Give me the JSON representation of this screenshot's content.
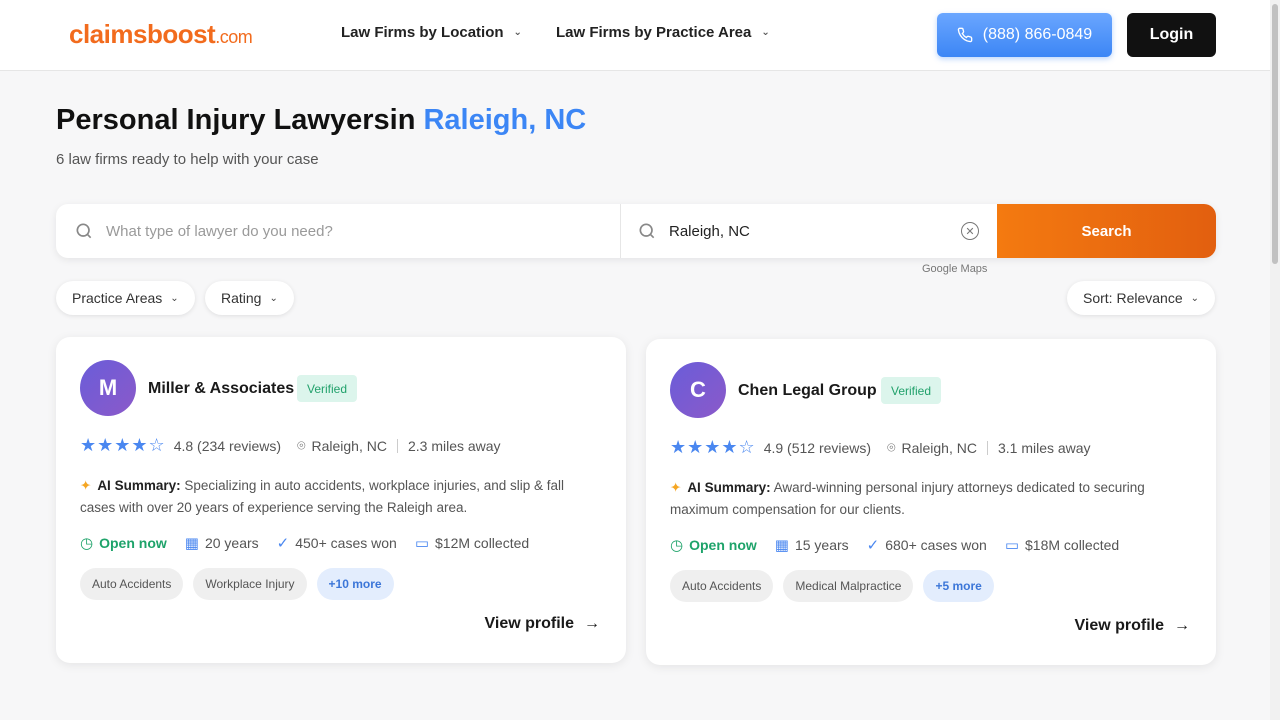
{
  "header": {
    "logo_main": "claimsboost",
    "logo_tld": ".com",
    "nav": [
      {
        "label": "Law Firms by Location"
      },
      {
        "label": "Law Firms by Practice Area"
      }
    ],
    "phone": "(888) 866-0849",
    "login": "Login"
  },
  "hero": {
    "title_prefix": "Personal Injury Lawyersin",
    "title_city": "Raleigh, NC",
    "subtitle": "6 law firms ready to help with your case"
  },
  "search": {
    "what_placeholder": "What type of lawyer do you need?",
    "location_value": "Raleigh, NC",
    "button": "Search",
    "attribution": "Google Maps"
  },
  "filters": {
    "practice_areas": "Practice Areas",
    "rating": "Rating",
    "sort": "Sort: Relevance"
  },
  "firms": [
    {
      "initial": "M",
      "name": "Miller & Associates",
      "verified": "Verified",
      "stars": "★★★★☆",
      "rating": "4.8 (234 reviews)",
      "location": "Raleigh, NC",
      "distance": "2.3 miles away",
      "summary_label": "AI Summary:",
      "summary": "Specializing in auto accidents, workplace injuries, and slip & fall cases with over 20 years of experience serving the Raleigh area.",
      "status": "Open now",
      "years": "20 years",
      "cases": "450+ cases won",
      "collected": "$12M collected",
      "tags": [
        "Auto Accidents",
        "Workplace Injury"
      ],
      "more": "+10 more",
      "view": "View profile"
    },
    {
      "initial": "C",
      "name": "Chen Legal Group",
      "verified": "Verified",
      "stars": "★★★★☆",
      "rating": "4.9 (512 reviews)",
      "location": "Raleigh, NC",
      "distance": "3.1 miles away",
      "summary_label": "AI Summary:",
      "summary": "Award-winning personal injury attorneys dedicated to securing maximum compensation for our clients.",
      "status": "Open now",
      "years": "15 years",
      "cases": "680+ cases won",
      "collected": "$18M collected",
      "tags": [
        "Auto Accidents",
        "Medical Malpractice"
      ],
      "more": "+5 more",
      "view": "View profile"
    }
  ]
}
